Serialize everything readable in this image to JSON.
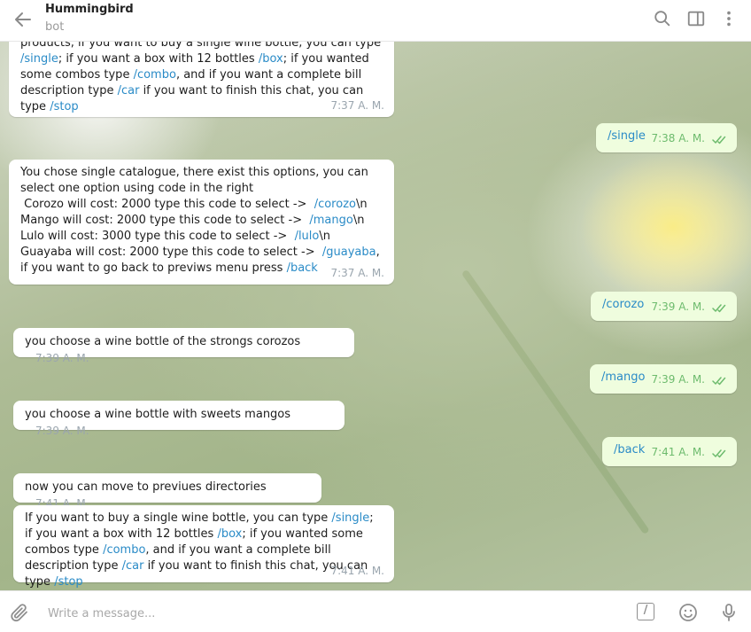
{
  "header": {
    "title": "Hummingbird",
    "subtitle": "bot"
  },
  "colors": {
    "accent": "#2a8bc7",
    "outgoing_bubble": "#effdde",
    "read_ticks": "#6dbb6d"
  },
  "messages": [
    {
      "dir": "in",
      "parts": [
        {
          "t": "products, if you want to buy a single wine bottle, you can type "
        },
        {
          "c": "/single"
        },
        {
          "t": "; if you want a box with 12 bottles "
        },
        {
          "c": "/box"
        },
        {
          "t": "; if you wanted some combos type "
        },
        {
          "c": "/combo"
        },
        {
          "t": ", and if you want a complete bill description type "
        },
        {
          "c": "/car"
        },
        {
          "t": " if you want to finish this chat, you can type "
        },
        {
          "c": "/stop"
        }
      ],
      "time": "7:37 A. M."
    },
    {
      "dir": "out",
      "text": "/single",
      "time": "7:38 A. M."
    },
    {
      "dir": "in",
      "parts": [
        {
          "t": "You chose single catalogue, there exist this options, you can select one option using code in the right\n Corozo will cost: 2000 type this code to select ->  "
        },
        {
          "c": "/corozo"
        },
        {
          "t": "\\n Mango will cost: 2000 type this code to select ->  "
        },
        {
          "c": "/mango"
        },
        {
          "t": "\\n Lulo will cost: 3000 type this code to select ->  "
        },
        {
          "c": "/lulo"
        },
        {
          "t": "\\n Guayaba will cost: 2000 type this code to select ->  "
        },
        {
          "c": "/guayaba"
        },
        {
          "t": ", if you want to go back to previws menu press "
        },
        {
          "c": "/back"
        }
      ],
      "time": "7:37 A. M."
    },
    {
      "dir": "out",
      "text": "/corozo",
      "time": "7:39 A. M."
    },
    {
      "dir": "in",
      "text": "you choose a wine bottle of the strongs corozos",
      "time": "7:39 A. M."
    },
    {
      "dir": "out",
      "text": "/mango",
      "time": "7:39 A. M."
    },
    {
      "dir": "in",
      "text": "you choose a wine bottle with sweets mangos",
      "time": "7:39 A. M."
    },
    {
      "dir": "out",
      "text": "/back",
      "time": "7:41 A. M."
    },
    {
      "dir": "in",
      "text": "now you can move to previues directories",
      "time": "7:41 A. M."
    },
    {
      "dir": "in",
      "parts": [
        {
          "t": "If you want to buy a single wine bottle, you can type "
        },
        {
          "c": "/single"
        },
        {
          "t": "; if you want a box with 12 bottles "
        },
        {
          "c": "/box"
        },
        {
          "t": "; if you wanted some combos type "
        },
        {
          "c": "/combo"
        },
        {
          "t": ", and if you want a complete bill description type "
        },
        {
          "c": "/car"
        },
        {
          "t": " if you want to finish this chat, you can type "
        },
        {
          "c": "/stop"
        }
      ],
      "time": "7:41 A. M."
    }
  ],
  "composer": {
    "placeholder": "Write a message...",
    "commands_icon_label": "/"
  },
  "icons": {
    "back": "arrow-left-icon",
    "search": "search-icon",
    "sidebar": "sidebar-toggle-icon",
    "menu": "more-vert-icon",
    "attach": "paperclip-icon",
    "commands": "bot-commands-icon",
    "emoji": "emoji-icon",
    "mic": "microphone-icon",
    "read": "double-check-icon"
  }
}
